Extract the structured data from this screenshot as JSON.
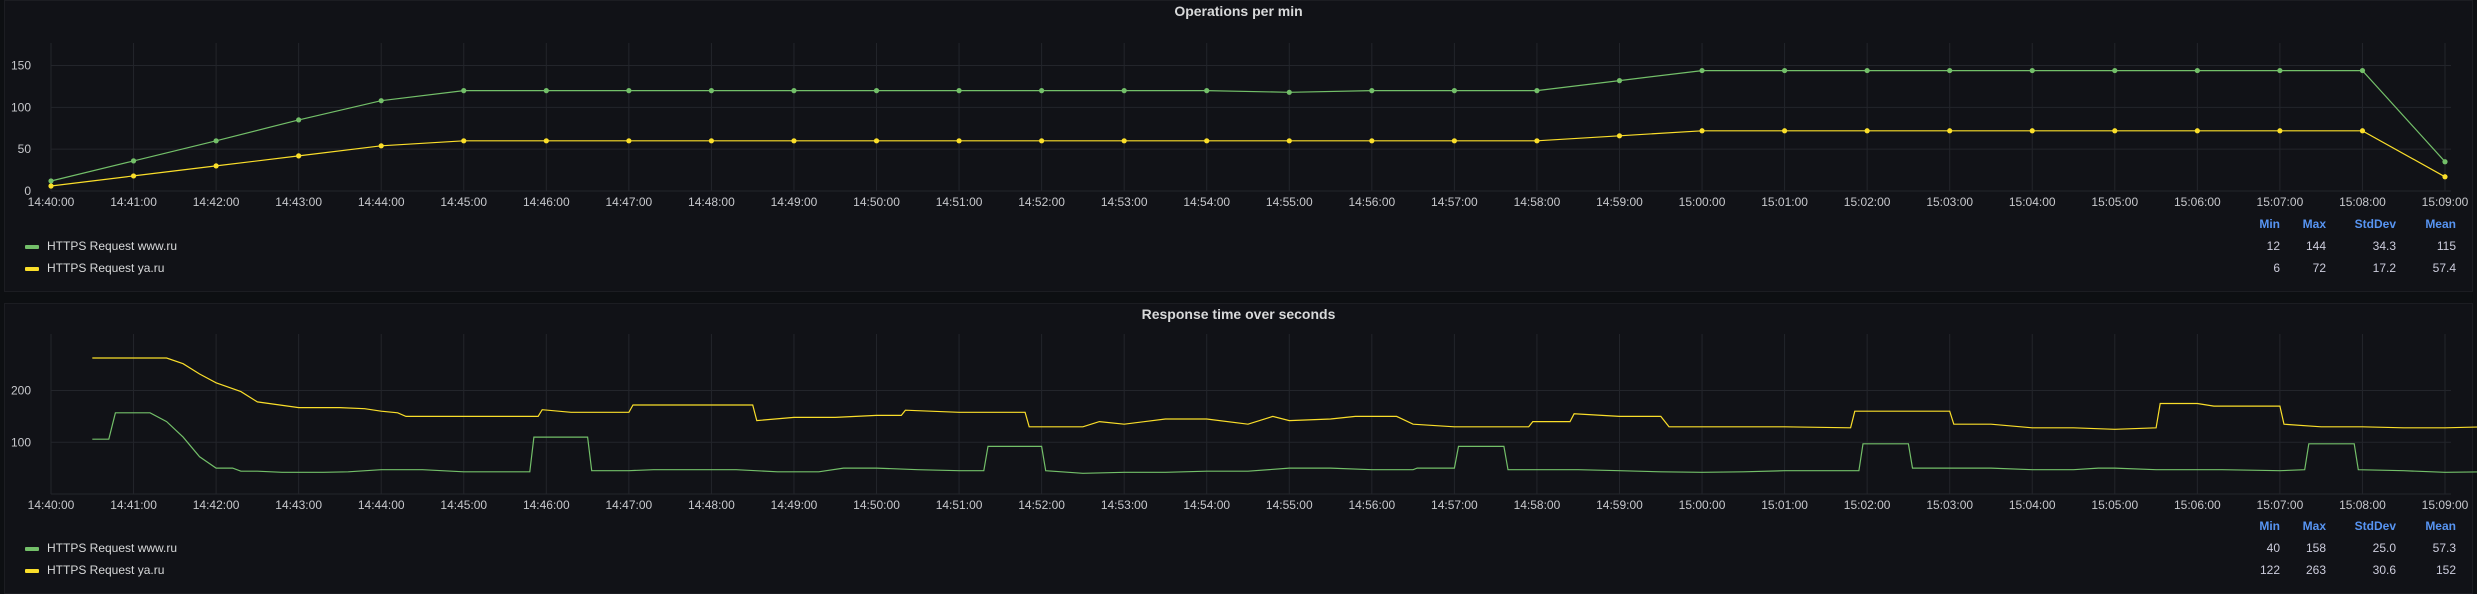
{
  "colors": {
    "www": "#73bf69",
    "ya": "#fade2a",
    "grid": "#23252b",
    "legendHeader": "#5794f2"
  },
  "xticks": [
    "14:40:00",
    "14:41:00",
    "14:42:00",
    "14:43:00",
    "14:44:00",
    "14:45:00",
    "14:46:00",
    "14:47:00",
    "14:48:00",
    "14:49:00",
    "14:50:00",
    "14:51:00",
    "14:52:00",
    "14:53:00",
    "14:54:00",
    "14:55:00",
    "14:56:00",
    "14:57:00",
    "14:58:00",
    "14:59:00",
    "15:00:00",
    "15:01:00",
    "15:02:00",
    "15:03:00",
    "15:04:00",
    "15:05:00",
    "15:06:00",
    "15:07:00",
    "15:08:00",
    "15:09:00"
  ],
  "chart_data": [
    {
      "type": "line",
      "title": "Operations per min",
      "ylim": [
        0,
        165
      ],
      "yticks": [
        "0",
        "50",
        "100",
        "150"
      ],
      "grid": true,
      "legend": {
        "placement": "bottom",
        "columns": [
          "Min",
          "Max",
          "StdDev",
          "Mean"
        ],
        "rows": [
          {
            "name": "HTTPS Request www.ru",
            "color": "#73bf69",
            "min": "12",
            "max": "144",
            "stddev": "34.3",
            "mean": "115"
          },
          {
            "name": "HTTPS Request ya.ru",
            "color": "#fade2a",
            "min": "6",
            "max": "72",
            "stddev": "17.2",
            "mean": "57.4"
          }
        ]
      },
      "series": [
        {
          "name": "HTTPS Request www.ru",
          "color": "#73bf69",
          "points": true,
          "values": [
            12,
            36,
            60,
            85,
            108,
            120,
            120,
            120,
            120,
            120,
            120,
            120,
            120,
            120,
            120,
            118,
            120,
            120,
            120,
            132,
            144,
            144,
            144,
            144,
            144,
            144,
            144,
            144,
            144,
            35
          ]
        },
        {
          "name": "HTTPS Request ya.ru",
          "color": "#fade2a",
          "points": true,
          "values": [
            6,
            18,
            30,
            42,
            54,
            60,
            60,
            60,
            60,
            60,
            60,
            60,
            60,
            60,
            60,
            60,
            60,
            60,
            60,
            66,
            72,
            72,
            72,
            72,
            72,
            72,
            72,
            72,
            72,
            17
          ]
        }
      ]
    },
    {
      "type": "line",
      "title": "Response time over seconds",
      "ylim": [
        0,
        290
      ],
      "yticks": [
        "100",
        "200"
      ],
      "grid": true,
      "legend": {
        "placement": "bottom",
        "columns": [
          "Min",
          "Max",
          "StdDev",
          "Mean"
        ],
        "rows": [
          {
            "name": "HTTPS Request www.ru",
            "color": "#73bf69",
            "min": "40",
            "max": "158",
            "stddev": "25.0",
            "mean": "57.3"
          },
          {
            "name": "HTTPS Request ya.ru",
            "color": "#fade2a",
            "min": "122",
            "max": "263",
            "stddev": "30.6",
            "mean": "152"
          }
        ]
      },
      "series": [
        {
          "name": "HTTPS Request www.ru",
          "color": "#73bf69",
          "points": false,
          "values": [
            [
              0.5,
              106
            ],
            [
              0.7,
              106
            ],
            [
              0.78,
              157
            ],
            [
              1.2,
              157
            ],
            [
              1.4,
              140
            ],
            [
              1.6,
              110
            ],
            [
              1.8,
              72
            ],
            [
              2.0,
              50
            ],
            [
              2.2,
              50
            ],
            [
              2.3,
              44
            ],
            [
              2.5,
              44
            ],
            [
              2.8,
              42
            ],
            [
              3.0,
              42
            ],
            [
              3.3,
              42
            ],
            [
              3.6,
              43
            ],
            [
              4.0,
              47
            ],
            [
              4.5,
              47
            ],
            [
              5.0,
              43
            ],
            [
              5.5,
              43
            ],
            [
              5.8,
              43
            ],
            [
              5.85,
              110
            ],
            [
              6.5,
              110
            ],
            [
              6.55,
              45
            ],
            [
              7.0,
              45
            ],
            [
              7.3,
              47
            ],
            [
              7.8,
              47
            ],
            [
              8.3,
              47
            ],
            [
              8.8,
              43
            ],
            [
              9.3,
              43
            ],
            [
              9.6,
              50
            ],
            [
              10.0,
              50
            ],
            [
              10.5,
              47
            ],
            [
              11.0,
              45
            ],
            [
              11.3,
              45
            ],
            [
              11.35,
              92
            ],
            [
              12.0,
              92
            ],
            [
              12.05,
              45
            ],
            [
              12.5,
              40
            ],
            [
              13.0,
              42
            ],
            [
              13.5,
              42
            ],
            [
              14.0,
              44
            ],
            [
              14.5,
              44
            ],
            [
              15.0,
              50
            ],
            [
              15.5,
              50
            ],
            [
              16.0,
              47
            ],
            [
              16.5,
              47
            ],
            [
              16.55,
              50
            ],
            [
              17.0,
              50
            ],
            [
              17.05,
              92
            ],
            [
              17.6,
              92
            ],
            [
              17.65,
              47
            ],
            [
              18.0,
              47
            ],
            [
              18.5,
              47
            ],
            [
              19.0,
              45
            ],
            [
              19.5,
              43
            ],
            [
              20.0,
              42
            ],
            [
              20.5,
              43
            ],
            [
              21.0,
              45
            ],
            [
              21.5,
              45
            ],
            [
              21.9,
              45
            ],
            [
              21.95,
              97
            ],
            [
              22.5,
              97
            ],
            [
              22.55,
              50
            ],
            [
              23.0,
              50
            ],
            [
              23.5,
              50
            ],
            [
              24.0,
              47
            ],
            [
              24.5,
              47
            ],
            [
              24.8,
              50
            ],
            [
              25.0,
              50
            ],
            [
              25.5,
              47
            ],
            [
              26.0,
              47
            ],
            [
              26.3,
              47
            ],
            [
              27.0,
              45
            ],
            [
              27.3,
              47
            ],
            [
              27.35,
              97
            ],
            [
              27.9,
              97
            ],
            [
              27.95,
              47
            ],
            [
              28.5,
              45
            ],
            [
              29.0,
              42
            ],
            [
              29.5,
              43
            ]
          ]
        },
        {
          "name": "HTTPS Request ya.ru",
          "color": "#fade2a",
          "points": false,
          "values": [
            [
              0.5,
              263
            ],
            [
              1.2,
              263
            ],
            [
              1.4,
              263
            ],
            [
              1.6,
              252
            ],
            [
              1.8,
              232
            ],
            [
              2.0,
              215
            ],
            [
              2.3,
              198
            ],
            [
              2.5,
              178
            ],
            [
              3.0,
              167
            ],
            [
              3.5,
              167
            ],
            [
              3.8,
              165
            ],
            [
              4.0,
              160
            ],
            [
              4.2,
              157
            ],
            [
              4.3,
              150
            ],
            [
              5.0,
              150
            ],
            [
              5.5,
              150
            ],
            [
              5.9,
              150
            ],
            [
              5.95,
              163
            ],
            [
              6.3,
              158
            ],
            [
              6.5,
              158
            ],
            [
              7.0,
              158
            ],
            [
              7.05,
              172
            ],
            [
              8.0,
              172
            ],
            [
              8.5,
              172
            ],
            [
              8.55,
              142
            ],
            [
              9.0,
              148
            ],
            [
              9.5,
              148
            ],
            [
              10.0,
              152
            ],
            [
              10.3,
              152
            ],
            [
              10.35,
              162
            ],
            [
              11.0,
              158
            ],
            [
              11.5,
              158
            ],
            [
              11.8,
              158
            ],
            [
              11.85,
              130
            ],
            [
              12.5,
              130
            ],
            [
              12.7,
              140
            ],
            [
              13.0,
              135
            ],
            [
              13.5,
              145
            ],
            [
              14.0,
              145
            ],
            [
              14.5,
              135
            ],
            [
              14.8,
              150
            ],
            [
              15.0,
              142
            ],
            [
              15.5,
              145
            ],
            [
              15.8,
              150
            ],
            [
              16.3,
              150
            ],
            [
              16.5,
              135
            ],
            [
              17.0,
              130
            ],
            [
              17.5,
              130
            ],
            [
              17.9,
              130
            ],
            [
              17.95,
              140
            ],
            [
              18.4,
              140
            ],
            [
              18.45,
              155
            ],
            [
              19.0,
              150
            ],
            [
              19.5,
              150
            ],
            [
              19.6,
              130
            ],
            [
              20.0,
              130
            ],
            [
              20.5,
              130
            ],
            [
              21.0,
              130
            ],
            [
              21.8,
              128
            ],
            [
              21.85,
              160
            ],
            [
              22.5,
              160
            ],
            [
              23.0,
              160
            ],
            [
              23.05,
              135
            ],
            [
              23.5,
              135
            ],
            [
              24.0,
              128
            ],
            [
              24.5,
              128
            ],
            [
              25.0,
              125
            ],
            [
              25.5,
              128
            ],
            [
              25.55,
              175
            ],
            [
              26.0,
              175
            ],
            [
              26.2,
              170
            ],
            [
              26.7,
              170
            ],
            [
              27.0,
              170
            ],
            [
              27.05,
              135
            ],
            [
              27.5,
              130
            ],
            [
              28.0,
              130
            ],
            [
              28.5,
              128
            ],
            [
              29.0,
              128
            ],
            [
              29.5,
              130
            ]
          ]
        }
      ]
    }
  ]
}
